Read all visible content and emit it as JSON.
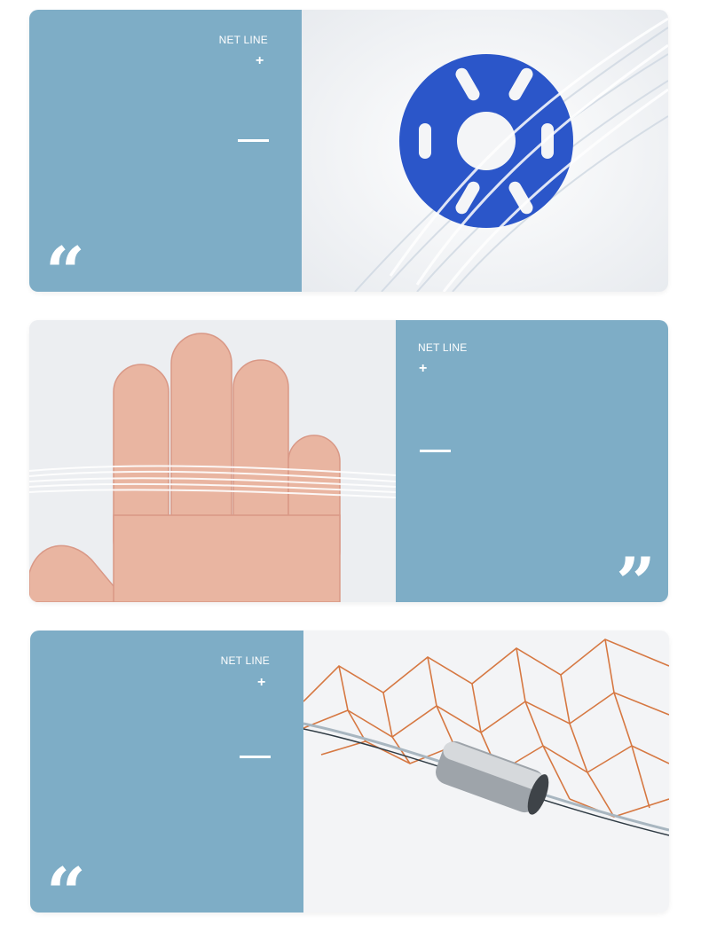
{
  "sections": [
    {
      "label": "NET LINE",
      "plus": "+",
      "quote": "“",
      "photo_icon": "spool-image",
      "accent": "#2b56c9"
    },
    {
      "label": "NET LINE",
      "plus": "+",
      "quote": "”",
      "photo_icon": "hand-image",
      "accent": "#e9b5a1"
    },
    {
      "label": "NET LINE",
      "plus": "+",
      "quote": "“",
      "photo_icon": "net-image",
      "accent": "#d36b2f"
    }
  ],
  "colors": {
    "panel": "#7eadc6",
    "text": "#ffffff"
  }
}
